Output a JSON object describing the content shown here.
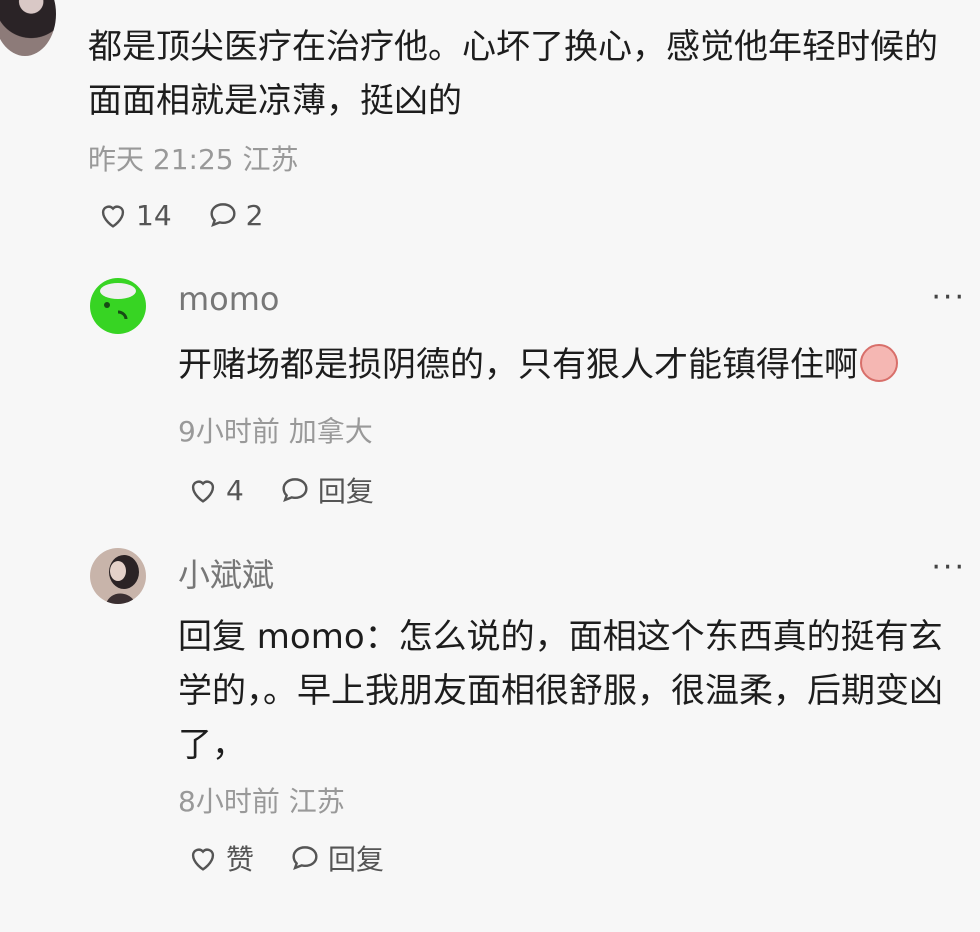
{
  "top_comment": {
    "text": "都是顶尖医疗在治疗他。心坏了换心，感觉他年轻时候的面面相就是凉薄，挺凶的",
    "time": "昨天 21:25",
    "location": "江苏",
    "likes": "14",
    "comments": "2"
  },
  "replies": [
    {
      "username": "momo",
      "text": "开赌场都是损阴德的，只有狠人才能镇得住啊",
      "time": "9小时前",
      "location": "加拿大",
      "likes": "4",
      "reply_label": "回复",
      "more": "···"
    },
    {
      "username": "小斌斌",
      "text": "回复 momo：怎么说的，面相这个东西真的挺有玄学的，。早上我朋友面相很舒服，很温柔，后期变凶了，",
      "time": "8小时前",
      "location": "江苏",
      "like_label": "赞",
      "reply_label": "回复",
      "more": "···"
    }
  ],
  "icons": {
    "like": "heart-outline-icon",
    "comment": "speech-bubble-icon",
    "more": "ellipsis-icon"
  }
}
